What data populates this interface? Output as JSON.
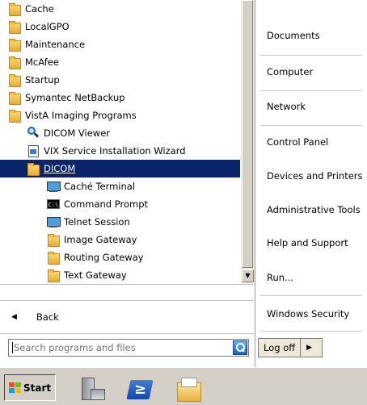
{
  "programs": [
    {
      "label": "Cache",
      "icon": "folder-icon",
      "indent": 0
    },
    {
      "label": "LocalGPO",
      "icon": "folder-icon",
      "indent": 0
    },
    {
      "label": "Maintenance",
      "icon": "folder-icon",
      "indent": 0
    },
    {
      "label": "McAfee",
      "icon": "folder-icon",
      "indent": 0
    },
    {
      "label": "Startup",
      "icon": "folder-icon",
      "indent": 0
    },
    {
      "label": "Symantec NetBackup",
      "icon": "folder-icon",
      "indent": 0
    },
    {
      "label": "VistA Imaging Programs",
      "icon": "folder-icon",
      "indent": 0
    },
    {
      "label": "DICOM Viewer",
      "icon": "magnifier-icon",
      "indent": 1
    },
    {
      "label": "VIX Service Installation Wizard",
      "icon": "installer-icon",
      "indent": 1
    },
    {
      "label": "DICOM",
      "icon": "folder-icon",
      "indent": 1,
      "selected": true
    },
    {
      "label": "Caché Terminal",
      "icon": "terminal-icon",
      "indent": 2
    },
    {
      "label": "Command Prompt",
      "icon": "cmd-icon",
      "indent": 2
    },
    {
      "label": "Telnet Session",
      "icon": "terminal-icon",
      "indent": 2
    },
    {
      "label": "Image Gateway",
      "icon": "folder-icon",
      "indent": 2
    },
    {
      "label": "Routing Gateway",
      "icon": "folder-icon",
      "indent": 2
    },
    {
      "label": "Text Gateway",
      "icon": "folder-icon",
      "indent": 2
    }
  ],
  "back_label": "Back",
  "search": {
    "placeholder": "Search programs and files"
  },
  "right_pane": {
    "items": [
      {
        "label": "Documents"
      },
      {
        "label": "Computer"
      },
      {
        "label": "Network"
      },
      {
        "label": "Control Panel"
      },
      {
        "label": "Devices and Printers"
      },
      {
        "label": "Administrative Tools"
      },
      {
        "label": "Help and Support"
      },
      {
        "label": "Run..."
      },
      {
        "label": "Windows Security"
      }
    ],
    "logoff_label": "Log off"
  },
  "taskbar": {
    "start_label": "Start",
    "pinned": [
      {
        "icon": "server-manager-icon"
      },
      {
        "icon": "powershell-icon"
      },
      {
        "icon": "explorer-folder-icon"
      }
    ]
  },
  "colors": {
    "selection": "#0a246a",
    "taskbar": "#d4d0c8"
  }
}
